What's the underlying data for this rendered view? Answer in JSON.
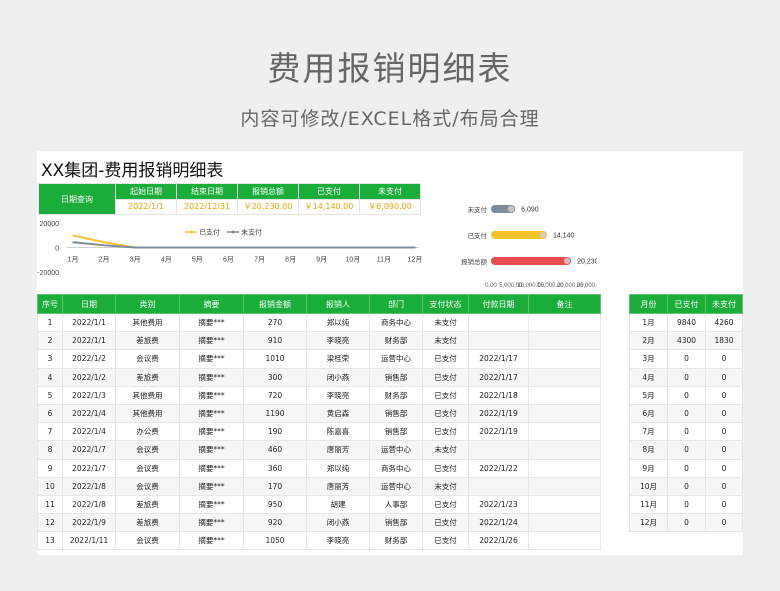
{
  "hero": {
    "title": "费用报销明细表",
    "subtitle": "内容可修改/EXCEL格式/布局合理"
  },
  "doc_title": "XX集团-费用报销明细表",
  "summary": {
    "query_label": "日期查询",
    "headers": [
      "起始日期",
      "结束日期",
      "报销总额",
      "已支付",
      "未支付"
    ],
    "values": [
      "2022/1/1",
      "2022/12/31",
      "￥20,230.00",
      "￥14,140.00",
      "￥6,090.00"
    ]
  },
  "colors": {
    "accent": "#1aad3a",
    "yellow": "#f5c32c",
    "gray": "#7f8c99",
    "red": "#e84c4c"
  },
  "chart_data": [
    {
      "type": "line",
      "categories": [
        "1月",
        "2月",
        "3月",
        "4月",
        "5月",
        "6月",
        "7月",
        "8月",
        "9月",
        "10月",
        "11月",
        "12月"
      ],
      "series": [
        {
          "name": "已支付",
          "values": [
            9840,
            4300,
            0,
            0,
            0,
            0,
            0,
            0,
            0,
            0,
            0,
            0
          ]
        },
        {
          "name": "未支付",
          "values": [
            4260,
            1830,
            0,
            0,
            0,
            0,
            0,
            0,
            0,
            0,
            0,
            0
          ]
        }
      ],
      "yticks": [
        "20000",
        "0",
        "-20000"
      ],
      "ylim": [
        -20000,
        20000
      ],
      "legend": "top"
    },
    {
      "type": "bar",
      "orientation": "horizontal",
      "categories": [
        "未支付",
        "已支付",
        "报销总额"
      ],
      "values": [
        6090,
        14140,
        20230
      ],
      "labels": [
        "6,090",
        "14,140",
        "20,230"
      ],
      "xticks": [
        "0.00",
        "5,000.00",
        "10,000.00",
        "15,000.00",
        "20,000.00",
        "25,000.00"
      ],
      "xlim": [
        0,
        25000
      ]
    }
  ],
  "table": {
    "headers": [
      "序号",
      "日期",
      "类别",
      "摘要",
      "报销金额",
      "报销人",
      "部门",
      "支付状态",
      "付款日期",
      "备注"
    ],
    "rows": [
      [
        "1",
        "2022/1/1",
        "其他费用",
        "摘要***",
        "270",
        "郑以纯",
        "商务中心",
        "未支付",
        "",
        ""
      ],
      [
        "2",
        "2022/1/1",
        "差旅费",
        "摘要***",
        "910",
        "李晓亮",
        "财务部",
        "未支付",
        "",
        ""
      ],
      [
        "3",
        "2022/1/2",
        "会议费",
        "摘要***",
        "1010",
        "梁桂荣",
        "运营中心",
        "已支付",
        "2022/1/17",
        ""
      ],
      [
        "4",
        "2022/1/2",
        "差旅费",
        "摘要***",
        "300",
        "闭小燕",
        "销售部",
        "已支付",
        "2022/1/17",
        ""
      ],
      [
        "5",
        "2022/1/3",
        "其他费用",
        "摘要***",
        "720",
        "李晓亮",
        "财务部",
        "已支付",
        "2022/1/18",
        ""
      ],
      [
        "6",
        "2022/1/4",
        "其他费用",
        "摘要***",
        "1190",
        "黄启森",
        "销售部",
        "已支付",
        "2022/1/19",
        ""
      ],
      [
        "7",
        "2022/1/4",
        "办公费",
        "摘要***",
        "190",
        "陈嘉喜",
        "销售部",
        "已支付",
        "2022/1/19",
        ""
      ],
      [
        "8",
        "2022/1/7",
        "会议费",
        "摘要***",
        "460",
        "唐丽芳",
        "运营中心",
        "未支付",
        "",
        ""
      ],
      [
        "9",
        "2022/1/7",
        "会议费",
        "摘要***",
        "360",
        "郑以纯",
        "商务中心",
        "已支付",
        "2022/1/22",
        ""
      ],
      [
        "10",
        "2022/1/8",
        "会议费",
        "摘要***",
        "170",
        "唐丽芳",
        "运营中心",
        "未支付",
        "",
        ""
      ],
      [
        "11",
        "2022/1/8",
        "差旅费",
        "摘要***",
        "950",
        "胡建",
        "人事部",
        "已支付",
        "2022/1/23",
        ""
      ],
      [
        "12",
        "2022/1/9",
        "差旅费",
        "摘要***",
        "920",
        "闭小燕",
        "销售部",
        "已支付",
        "2022/1/24",
        ""
      ],
      [
        "13",
        "2022/1/11",
        "会议费",
        "摘要***",
        "1050",
        "李晓亮",
        "财务部",
        "已支付",
        "2022/1/26",
        ""
      ]
    ]
  },
  "monthly": {
    "headers": [
      "月份",
      "已支付",
      "未支付"
    ],
    "rows": [
      [
        "1月",
        "9840",
        "4260"
      ],
      [
        "2月",
        "4300",
        "1830"
      ],
      [
        "3月",
        "0",
        "0"
      ],
      [
        "4月",
        "0",
        "0"
      ],
      [
        "5月",
        "0",
        "0"
      ],
      [
        "6月",
        "0",
        "0"
      ],
      [
        "7月",
        "0",
        "0"
      ],
      [
        "8月",
        "0",
        "0"
      ],
      [
        "9月",
        "0",
        "0"
      ],
      [
        "10月",
        "0",
        "0"
      ],
      [
        "11月",
        "0",
        "0"
      ],
      [
        "12月",
        "0",
        "0"
      ]
    ]
  }
}
